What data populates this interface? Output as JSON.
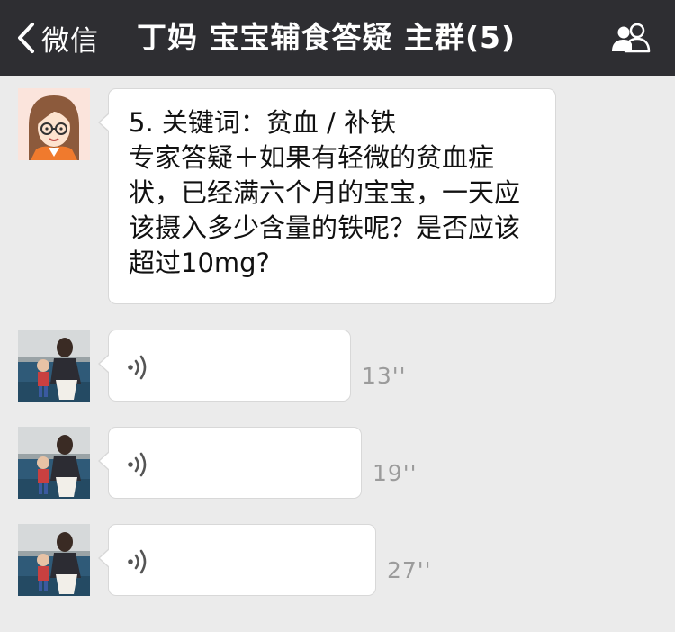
{
  "nav": {
    "back_label": "微信",
    "title": "丁妈 宝宝辅食答疑 主群(5)",
    "members_icon": "group-members-icon"
  },
  "messages": [
    {
      "type": "text",
      "avatar": "cartoon-woman-avatar",
      "text": "5. 关键词：贫血 / 补铁\n专家答疑＋如果有轻微的贫血症状，已经满六个月的宝宝，一天应该摄入多少含量的铁呢？是否应该超过10mg?"
    },
    {
      "type": "voice",
      "avatar": "photo-avatar",
      "icon": "voice-wave-icon",
      "duration": "13''"
    },
    {
      "type": "voice",
      "avatar": "photo-avatar",
      "icon": "voice-wave-icon",
      "duration": "19''"
    },
    {
      "type": "voice",
      "avatar": "photo-avatar",
      "icon": "voice-wave-icon",
      "duration": "27''"
    }
  ],
  "colors": {
    "nav_bg": "#2e2e32",
    "chat_bg": "#ebebeb",
    "bubble_bg": "#ffffff",
    "duration_text": "#9b9b9b"
  }
}
